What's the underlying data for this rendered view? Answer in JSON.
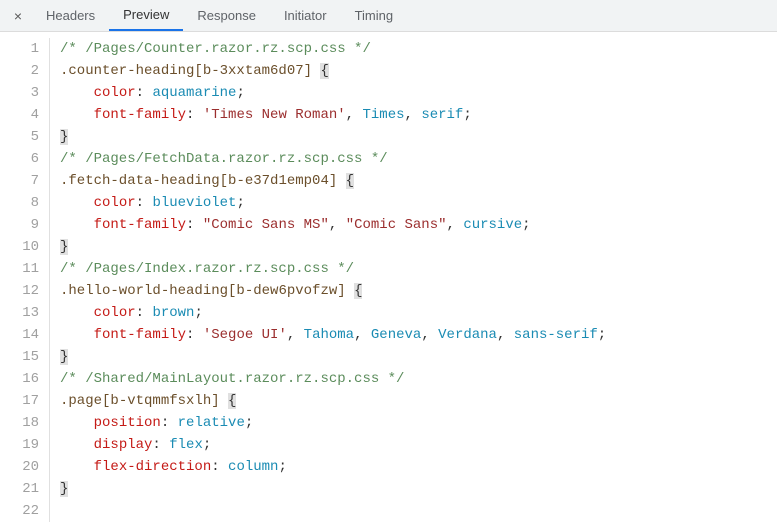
{
  "tabbar": {
    "close_label": "×",
    "tabs": [
      {
        "label": "Headers",
        "active": false
      },
      {
        "label": "Preview",
        "active": true
      },
      {
        "label": "Response",
        "active": false
      },
      {
        "label": "Initiator",
        "active": false
      },
      {
        "label": "Timing",
        "active": false
      }
    ]
  },
  "code": {
    "indent": "    ",
    "lines": [
      {
        "n": 1,
        "tokens": [
          {
            "t": "comment",
            "v": "/* /Pages/Counter.razor.rz.scp.css */"
          }
        ]
      },
      {
        "n": 2,
        "tokens": [
          {
            "t": "selector",
            "v": ".counter-heading"
          },
          {
            "t": "attrsel",
            "v": "[b-3xxtam6d07]"
          },
          {
            "t": "plain",
            "v": " "
          },
          {
            "t": "brace",
            "v": "{"
          }
        ]
      },
      {
        "n": 3,
        "indent": true,
        "tokens": [
          {
            "t": "prop",
            "v": "color"
          },
          {
            "t": "colon",
            "v": ": "
          },
          {
            "t": "value",
            "v": "aquamarine"
          },
          {
            "t": "punc",
            "v": ";"
          }
        ]
      },
      {
        "n": 4,
        "indent": true,
        "tokens": [
          {
            "t": "prop",
            "v": "font-family"
          },
          {
            "t": "colon",
            "v": ": "
          },
          {
            "t": "string",
            "v": "'Times New Roman'"
          },
          {
            "t": "punc",
            "v": ", "
          },
          {
            "t": "value",
            "v": "Times"
          },
          {
            "t": "punc",
            "v": ", "
          },
          {
            "t": "value",
            "v": "serif"
          },
          {
            "t": "punc",
            "v": ";"
          }
        ]
      },
      {
        "n": 5,
        "tokens": [
          {
            "t": "brace",
            "v": "}"
          }
        ]
      },
      {
        "n": 6,
        "tokens": [
          {
            "t": "comment",
            "v": "/* /Pages/FetchData.razor.rz.scp.css */"
          }
        ]
      },
      {
        "n": 7,
        "tokens": [
          {
            "t": "selector",
            "v": ".fetch-data-heading"
          },
          {
            "t": "attrsel",
            "v": "[b-e37d1emp04]"
          },
          {
            "t": "plain",
            "v": " "
          },
          {
            "t": "brace",
            "v": "{"
          }
        ]
      },
      {
        "n": 8,
        "indent": true,
        "tokens": [
          {
            "t": "prop",
            "v": "color"
          },
          {
            "t": "colon",
            "v": ": "
          },
          {
            "t": "value",
            "v": "blueviolet"
          },
          {
            "t": "punc",
            "v": ";"
          }
        ]
      },
      {
        "n": 9,
        "indent": true,
        "tokens": [
          {
            "t": "prop",
            "v": "font-family"
          },
          {
            "t": "colon",
            "v": ": "
          },
          {
            "t": "string",
            "v": "\"Comic Sans MS\""
          },
          {
            "t": "punc",
            "v": ", "
          },
          {
            "t": "string",
            "v": "\"Comic Sans\""
          },
          {
            "t": "punc",
            "v": ", "
          },
          {
            "t": "value",
            "v": "cursive"
          },
          {
            "t": "punc",
            "v": ";"
          }
        ]
      },
      {
        "n": 10,
        "tokens": [
          {
            "t": "brace",
            "v": "}"
          }
        ]
      },
      {
        "n": 11,
        "tokens": [
          {
            "t": "comment",
            "v": "/* /Pages/Index.razor.rz.scp.css */"
          }
        ]
      },
      {
        "n": 12,
        "tokens": [
          {
            "t": "selector",
            "v": ".hello-world-heading"
          },
          {
            "t": "attrsel",
            "v": "[b-dew6pvofzw]"
          },
          {
            "t": "plain",
            "v": " "
          },
          {
            "t": "brace",
            "v": "{"
          }
        ]
      },
      {
        "n": 13,
        "indent": true,
        "tokens": [
          {
            "t": "prop",
            "v": "color"
          },
          {
            "t": "colon",
            "v": ": "
          },
          {
            "t": "value",
            "v": "brown"
          },
          {
            "t": "punc",
            "v": ";"
          }
        ]
      },
      {
        "n": 14,
        "indent": true,
        "tokens": [
          {
            "t": "prop",
            "v": "font-family"
          },
          {
            "t": "colon",
            "v": ": "
          },
          {
            "t": "string",
            "v": "'Segoe UI'"
          },
          {
            "t": "punc",
            "v": ", "
          },
          {
            "t": "value",
            "v": "Tahoma"
          },
          {
            "t": "punc",
            "v": ", "
          },
          {
            "t": "value",
            "v": "Geneva"
          },
          {
            "t": "punc",
            "v": ", "
          },
          {
            "t": "value",
            "v": "Verdana"
          },
          {
            "t": "punc",
            "v": ", "
          },
          {
            "t": "value",
            "v": "sans-serif"
          },
          {
            "t": "punc",
            "v": ";"
          }
        ]
      },
      {
        "n": 15,
        "tokens": [
          {
            "t": "brace",
            "v": "}"
          }
        ]
      },
      {
        "n": 16,
        "tokens": [
          {
            "t": "comment",
            "v": "/* /Shared/MainLayout.razor.rz.scp.css */"
          }
        ]
      },
      {
        "n": 17,
        "tokens": [
          {
            "t": "selector",
            "v": ".page"
          },
          {
            "t": "attrsel",
            "v": "[b-vtqmmfsxlh]"
          },
          {
            "t": "plain",
            "v": " "
          },
          {
            "t": "brace",
            "v": "{"
          }
        ]
      },
      {
        "n": 18,
        "indent": true,
        "tokens": [
          {
            "t": "prop",
            "v": "position"
          },
          {
            "t": "colon",
            "v": ": "
          },
          {
            "t": "value",
            "v": "relative"
          },
          {
            "t": "punc",
            "v": ";"
          }
        ]
      },
      {
        "n": 19,
        "indent": true,
        "tokens": [
          {
            "t": "prop",
            "v": "display"
          },
          {
            "t": "colon",
            "v": ": "
          },
          {
            "t": "value",
            "v": "flex"
          },
          {
            "t": "punc",
            "v": ";"
          }
        ]
      },
      {
        "n": 20,
        "indent": true,
        "tokens": [
          {
            "t": "prop",
            "v": "flex-direction"
          },
          {
            "t": "colon",
            "v": ": "
          },
          {
            "t": "value",
            "v": "column"
          },
          {
            "t": "punc",
            "v": ";"
          }
        ]
      },
      {
        "n": 21,
        "tokens": [
          {
            "t": "brace",
            "v": "}"
          }
        ]
      },
      {
        "n": 22,
        "tokens": []
      }
    ]
  }
}
